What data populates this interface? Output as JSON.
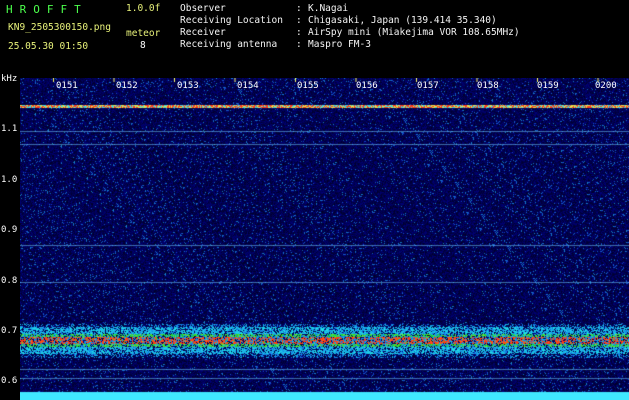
{
  "header": {
    "logo": "HROFFT",
    "version": "1.0.0f",
    "filename": "KN9_2505300150.png",
    "meteor_label": "meteor",
    "meteor_count": "8",
    "datetime": "25.05.30 01:50"
  },
  "info": [
    {
      "key": "Observer",
      "value": "K.Nagai"
    },
    {
      "key": "Receiving Location",
      "value": "Chigasaki, Japan (139.414 35.340)"
    },
    {
      "key": "Receiver",
      "value": "AirSpy mini (Miakejima VOR 108.65MHz)"
    },
    {
      "key": "Receiving antenna",
      "value": "Maspro FM-3"
    }
  ],
  "axis": {
    "unit": "kHz",
    "freq_labels": [
      "1.1",
      "1.0",
      "0.9",
      "0.8",
      "0.7",
      "0.6"
    ],
    "time_labels": [
      "0151",
      "0152",
      "0153",
      "0154",
      "0155",
      "0156",
      "0157",
      "0158",
      "0159",
      "0200"
    ]
  },
  "colors": {
    "background": "#000000",
    "logo": "#4cff4c",
    "noise_base": "#0a1a8c",
    "strong_band": "#ff3a1a",
    "band_cyan": "#40e8ff"
  }
}
